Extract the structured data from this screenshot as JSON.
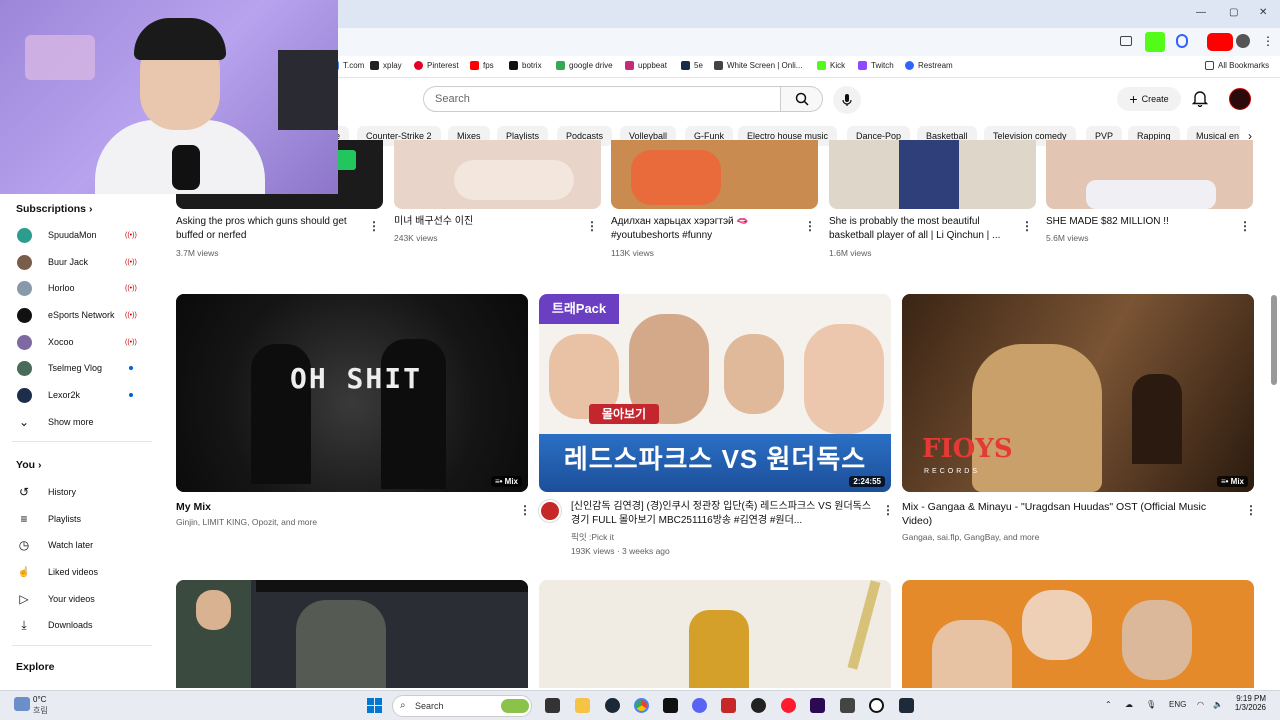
{
  "bookmarks": [
    {
      "label": "T.com",
      "color": "#4285f4"
    },
    {
      "label": "xplay",
      "color": "#222"
    },
    {
      "label": "Pinterest",
      "color": "#e60023"
    },
    {
      "label": "fps",
      "color": "#ff0000"
    },
    {
      "label": "botrix",
      "color": "#111"
    },
    {
      "label": "google drive",
      "color": "#34a853"
    },
    {
      "label": "uppbeat",
      "color": "#c72a7c"
    },
    {
      "label": "5e",
      "color": "#1b2a49"
    },
    {
      "label": "White Screen | Onli...",
      "color": "#444"
    },
    {
      "label": "Kick",
      "color": "#53fc18"
    },
    {
      "label": "Twitch",
      "color": "#9146ff"
    },
    {
      "label": "Restream",
      "color": "#3164ff"
    }
  ],
  "all_bookmarks": "All Bookmarks",
  "search": {
    "placeholder": "Search"
  },
  "create_label": "Create",
  "chips": [
    "e",
    "Counter-Strike 2",
    "Mixes",
    "Playlists",
    "Podcasts",
    "Volleyball",
    "G-Funk",
    "Electro house music",
    "Dance-Pop",
    "Basketball",
    "Television comedy",
    "PVP",
    "Rapping",
    "Musical en"
  ],
  "sidebar": {
    "subscriptions_title": "Subscriptions",
    "subscriptions": [
      {
        "name": "SpuudaMon",
        "status": "live",
        "color": "#2a9d8f"
      },
      {
        "name": "Buur Jack",
        "status": "live",
        "color": "#7a5c4a"
      },
      {
        "name": "Horloo",
        "status": "live",
        "color": "#8899aa"
      },
      {
        "name": "eSports Network",
        "status": "live",
        "color": "#111"
      },
      {
        "name": "Xocoo",
        "status": "live",
        "color": "#7d6aa0"
      },
      {
        "name": "Tselmeg Vlog",
        "status": "new",
        "color": "#4a6a5a"
      },
      {
        "name": "Lexor2k",
        "status": "new",
        "color": "#1c2e4a"
      }
    ],
    "show_more": "Show more",
    "you_title": "You",
    "you_items": [
      {
        "label": "History",
        "icon": "history-icon",
        "glyph": "↺"
      },
      {
        "label": "Playlists",
        "icon": "playlists-icon",
        "glyph": "≡"
      },
      {
        "label": "Watch later",
        "icon": "clock-icon",
        "glyph": "◷"
      },
      {
        "label": "Liked videos",
        "icon": "thumbs-up-icon",
        "glyph": "👍"
      },
      {
        "label": "Your videos",
        "icon": "video-icon",
        "glyph": "▷"
      },
      {
        "label": "Downloads",
        "icon": "download-icon",
        "glyph": "⤓"
      }
    ],
    "explore_title": "Explore"
  },
  "shorts": [
    {
      "title": "Asking the pros which guns should get buffed or nerfed",
      "views": "3.7M views"
    },
    {
      "title": "미녀 배구선수 이진",
      "views": "243K views"
    },
    {
      "title": "Адилхан харьцах хэрэгтэй 🫦 #youtubeshorts #funny",
      "views": "113K views"
    },
    {
      "title": "She is probably the most beautiful basketball player of all | Li Qinchun | ...",
      "views": "1.6M views"
    },
    {
      "title": "SHE MADE $82 MILLION !!",
      "views": "5.6M views"
    }
  ],
  "videos": [
    {
      "title": "My Mix",
      "meta1": "Ginjin, LIMIT KING, Opozit, and more",
      "meta2": "",
      "badge": "Mix",
      "thumb_text": "OH SHIT"
    },
    {
      "title": "[신인감독 김연경] (경)인쿠시 정관장 입단(축) 레드스파크스 VS 원더독스 경기 FULL 몰아보기 MBC251116방송 #김연경 #원더...",
      "meta1": "픽잇 :Pick it",
      "meta2": "193K views · 3 weeks ago",
      "badge": "2:24:55",
      "thumb_text": "레드스파크스 VS 원더독스",
      "thumb_top": "트래Pack",
      "thumb_mid": "몰아보기"
    },
    {
      "title": "Mix - Gangaa & Minayu - \"Uragdsan Huudas\" OST (Official Music Video)",
      "meta1": "Gangaa, sai.flp, GangBay, and more",
      "meta2": "",
      "badge": "Mix",
      "thumb_text": "FIOYS",
      "thumb_sub": "RECORDS"
    }
  ],
  "taskbar": {
    "weather_temp": "0°C",
    "weather_desc": "흐림",
    "search": "Search",
    "lang": "ENG",
    "time": "9:19 PM",
    "date": "1/3/2026"
  }
}
